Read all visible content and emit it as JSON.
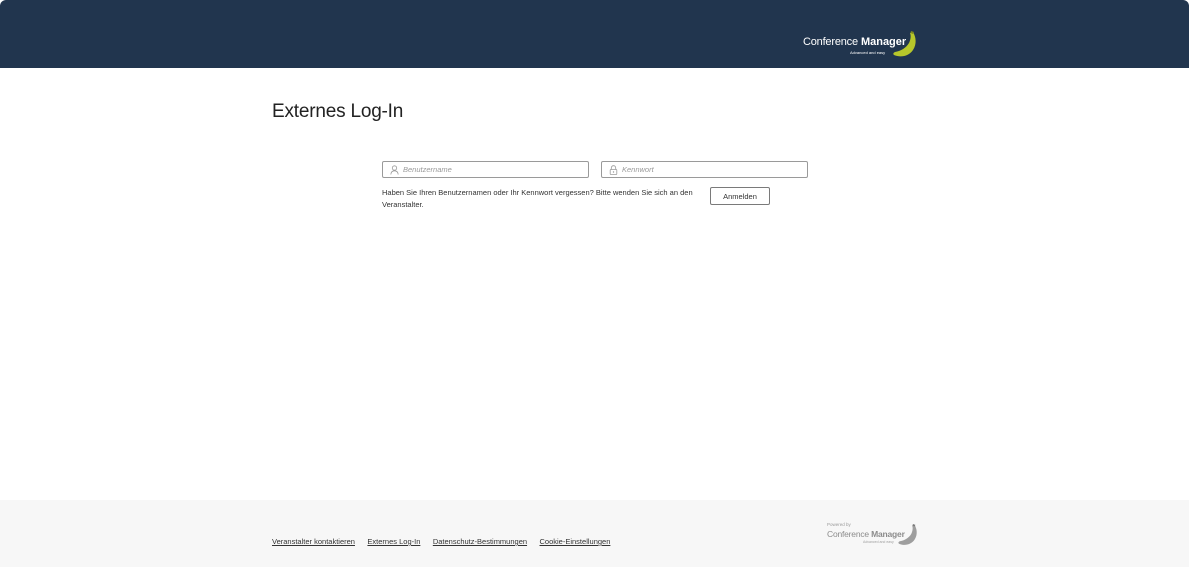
{
  "header": {
    "brand_light": "Conference",
    "brand_bold": "Manager",
    "brand_tagline": "Advanced and easy",
    "brand_color": "#b7c72b",
    "background": "#21354e"
  },
  "main": {
    "title": "Externes Log-In",
    "username_placeholder": "Benutzername",
    "password_placeholder": "Kennwort",
    "username_icon": "user-icon",
    "password_icon": "lock-icon",
    "forgot_hint": "Haben Sie Ihren Benutzernamen oder Ihr Kennwort vergessen? Bitte wenden Sie sich an den Veranstalter.",
    "login_label": "Anmelden"
  },
  "footer": {
    "links": [
      "Veranstalter kontaktieren",
      "Externes Log-In",
      "Datenschutz-Bestimmungen",
      "Cookie-Einstellungen"
    ],
    "powered_label": "Powered by",
    "powered_light": "Conference",
    "powered_bold": "Manager",
    "powered_tagline": "Advanced and easy"
  }
}
